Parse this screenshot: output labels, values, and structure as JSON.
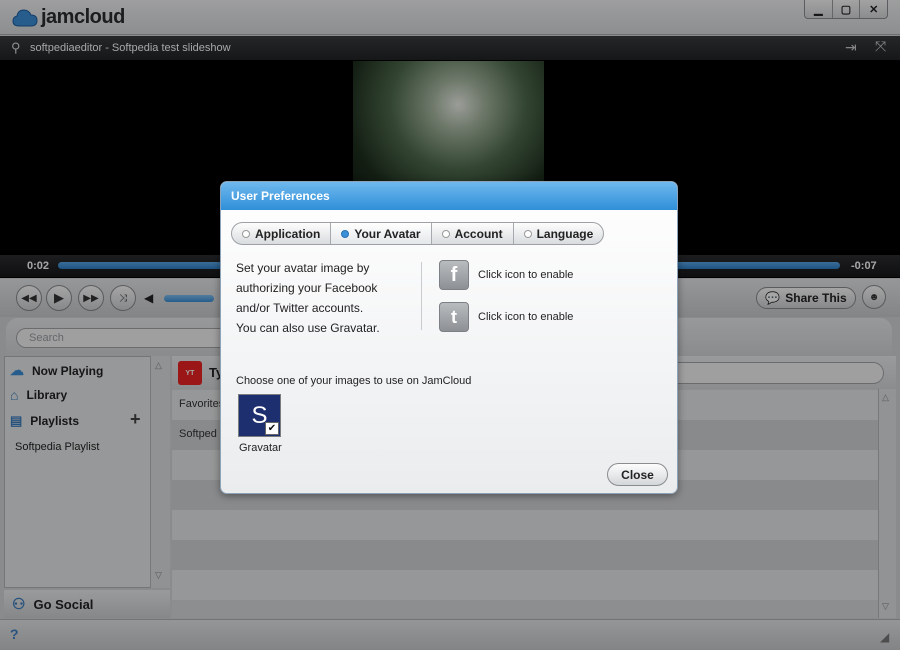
{
  "app": {
    "title": "jamcloud"
  },
  "player": {
    "video_title": "softpediaeditor - Softpedia test slideshow",
    "time_elapsed": "0:02",
    "time_remaining": "-0:07"
  },
  "controls": {
    "share_label": "Share This"
  },
  "search": {
    "placeholder": "Search"
  },
  "sidebar": {
    "items": [
      {
        "label": "Now Playing",
        "icon": "cloud-icon"
      },
      {
        "label": "Library",
        "icon": "home-icon"
      },
      {
        "label": "Playlists",
        "icon": "document-icon"
      }
    ],
    "playlists": [
      "Softpedia Playlist"
    ],
    "go_social": "Go Social"
  },
  "main": {
    "header_partial": "Ty",
    "rows": [
      "Favorites",
      "Softped"
    ]
  },
  "dialog": {
    "title": "User Preferences",
    "tabs": [
      {
        "label": "Application",
        "active": false
      },
      {
        "label": "Your Avatar",
        "active": true
      },
      {
        "label": "Account",
        "active": false
      },
      {
        "label": "Language",
        "active": false
      }
    ],
    "description": [
      "Set your avatar image by",
      "authorizing your Facebook",
      "and/or Twitter accounts.",
      "You can also use Gravatar."
    ],
    "facebook_text": "Click icon to enable",
    "twitter_text": "Click icon to enable",
    "choose_text": "Choose one of your images to use on JamCloud",
    "gravatar_label": "Gravatar",
    "close_label": "Close"
  },
  "colors": {
    "accent": "#2f8fd8",
    "seek": "#3a8fd9"
  }
}
